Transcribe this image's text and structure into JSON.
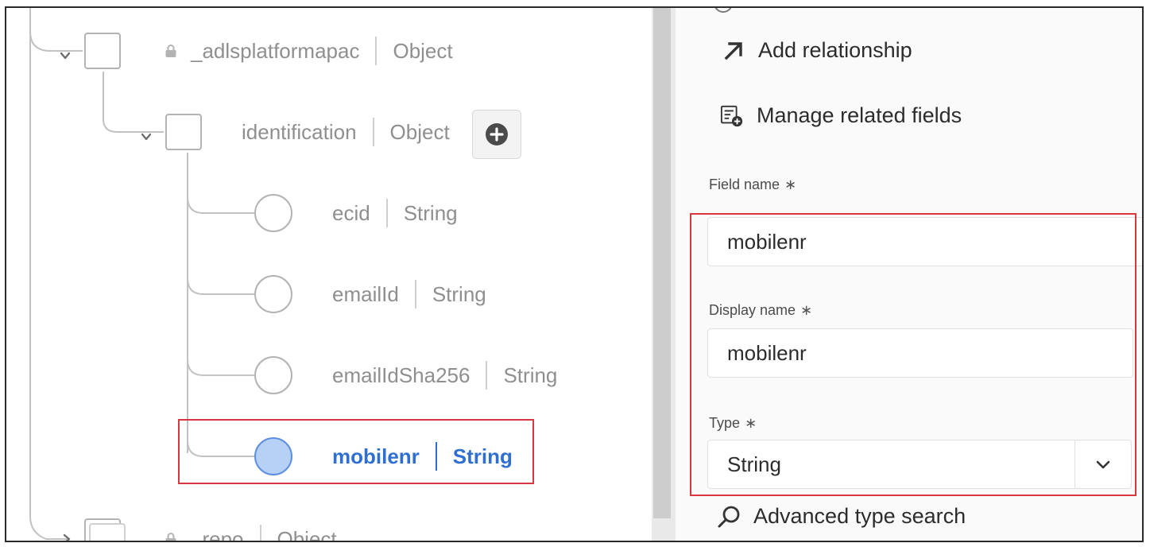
{
  "tree": {
    "nodes": [
      {
        "name": "_adlsplatformapac",
        "type": "Object",
        "locked": true
      },
      {
        "name": "identification",
        "type": "Object"
      },
      {
        "name": "ecid",
        "type": "String"
      },
      {
        "name": "emailId",
        "type": "String"
      },
      {
        "name": "emailIdSha256",
        "type": "String"
      },
      {
        "name": "mobilenr",
        "type": "String",
        "selected": true
      },
      {
        "name": "_repo",
        "type": "Object",
        "locked": true
      }
    ]
  },
  "properties": {
    "add_relationship_label": "Add relationship",
    "manage_related_fields_label": "Manage related fields",
    "field_name": {
      "label": "Field name",
      "required_mark": "∗",
      "value": "mobilenr"
    },
    "display_name": {
      "label": "Display name",
      "required_mark": "∗",
      "value": "mobilenr"
    },
    "type": {
      "label": "Type",
      "required_mark": "∗",
      "value": "String"
    },
    "advanced_type_search_label": "Advanced type search"
  },
  "colors": {
    "accent_blue": "#2f6fd1",
    "highlight_red": "#d9363e",
    "selected_node_fill": "#b7d1f6"
  },
  "icons": [
    "lock-icon",
    "chevron-down-icon",
    "chevron-right-icon",
    "add-circle-icon",
    "arrow-up-right-icon",
    "manage-fields-icon",
    "search-icon"
  ]
}
